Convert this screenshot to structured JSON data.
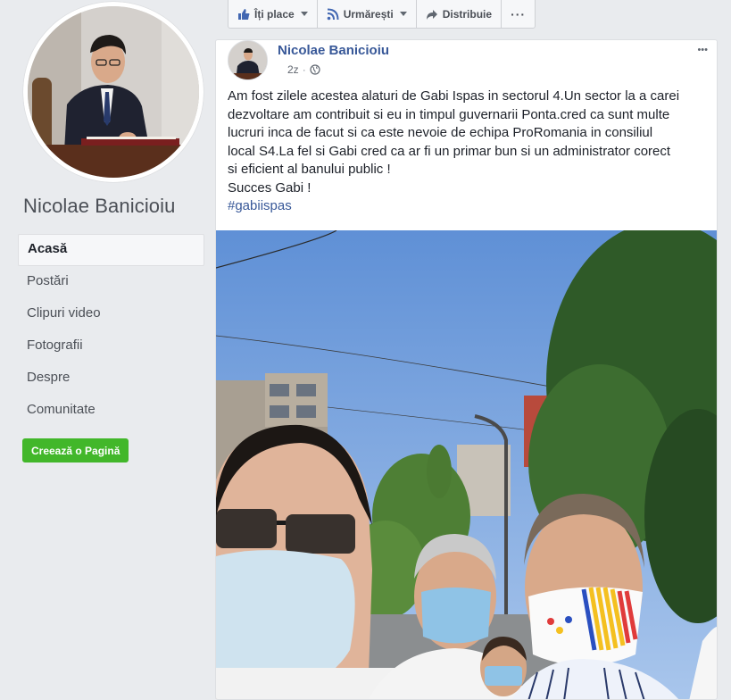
{
  "profile": {
    "name": "Nicolae Banicioiu",
    "avatar_icon": "profile-photo"
  },
  "nav": {
    "items": [
      {
        "label": "Acasă",
        "active": true
      },
      {
        "label": "Postări",
        "active": false
      },
      {
        "label": "Clipuri video",
        "active": false
      },
      {
        "label": "Fotografii",
        "active": false
      },
      {
        "label": "Despre",
        "active": false
      },
      {
        "label": "Comunitate",
        "active": false
      }
    ],
    "create_label": "Creează o Pagină"
  },
  "actions": {
    "like": "Îți place",
    "follow": "Urmărești",
    "share": "Distribuie",
    "more": "···"
  },
  "post": {
    "author": "Nicolae Banicioiu",
    "time": "2z",
    "menu": "•••",
    "lines": [
      "Am fost zilele acestea alaturi de Gabi Ispas in sectorul 4.Un sector la a carei",
      "dezvoltare am contribuit si eu in timpul guvernarii Ponta.cred ca sunt multe",
      "lucruri inca de facut si ca este nevoie de echipa ProRomania in consiliul",
      "local S4.La fel si Gabi cred ca ar fi un primar bun si un administrator corect",
      "si eficient al banului public !",
      "Succes Gabi !"
    ],
    "hashtag": "#gabiispas"
  },
  "colors": {
    "link": "#385898",
    "green": "#42b72a",
    "background": "#e9ebee"
  }
}
